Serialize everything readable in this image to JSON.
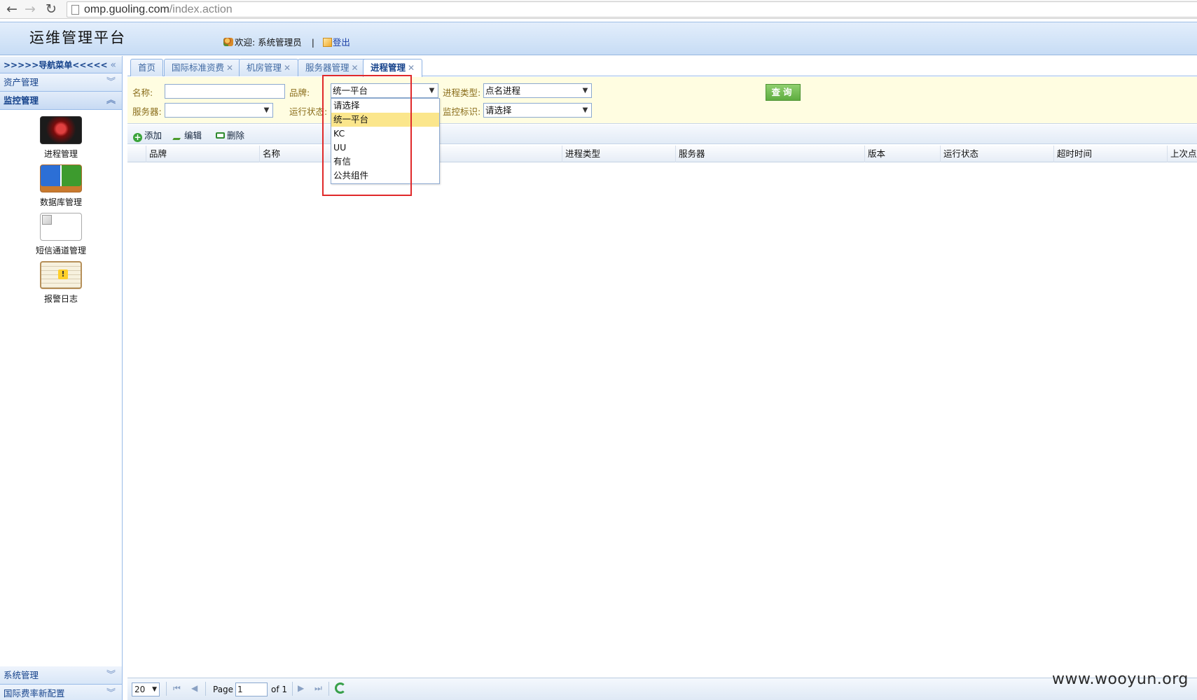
{
  "browser": {
    "url_host": "omp.guoling.com",
    "url_path": "/index.action",
    "back_glyph": "←",
    "forward_glyph": "→",
    "reload_glyph": "↻"
  },
  "header": {
    "title": "运维管理平台",
    "welcome": "欢迎:  系统管理员",
    "separator": "|",
    "logout": "登出"
  },
  "sidebar": {
    "nav_title": ">>>>>导航菜单<<<<<",
    "sections": [
      {
        "label": "资产管理",
        "expanded": false
      },
      {
        "label": "监控管理",
        "expanded": true
      },
      {
        "label": "系统管理",
        "expanded": false
      },
      {
        "label": "国际费率新配置",
        "expanded": false
      }
    ],
    "modules": [
      {
        "label": "进程管理",
        "icon": "process-icon"
      },
      {
        "label": "数据库管理",
        "icon": "database-icon"
      },
      {
        "label": "短信通道管理",
        "icon": "sms-channel-icon"
      },
      {
        "label": "报警日志",
        "icon": "alarm-log-icon"
      }
    ],
    "collapse_glyph": "«",
    "expand_glyph": "»"
  },
  "tabs": [
    {
      "label": "首页",
      "closable": false,
      "active": false
    },
    {
      "label": "国际标准资费",
      "closable": true,
      "active": false
    },
    {
      "label": "机房管理",
      "closable": true,
      "active": false
    },
    {
      "label": "服务器管理",
      "closable": true,
      "active": false
    },
    {
      "label": "进程管理",
      "closable": true,
      "active": true
    }
  ],
  "filter": {
    "name_label": "名称:",
    "name_value": "",
    "brand_label": "品牌:",
    "brand_value": "统一平台",
    "process_type_label": "进程类型:",
    "process_type_value": "点名进程",
    "server_label": "服务器:",
    "server_value": "",
    "run_status_label": "运行状态:",
    "monitor_flag_label": "监控标识:",
    "monitor_flag_value": "请选择",
    "query_button": "查询"
  },
  "brand_dropdown": {
    "options": [
      "请选择",
      "统一平台",
      "KC",
      "UU",
      "有信",
      "公共组件"
    ],
    "selected_index": 1
  },
  "toolbar": {
    "add": "添加",
    "edit": "编辑",
    "delete": "删除"
  },
  "grid": {
    "columns": [
      "品牌",
      "名称",
      "进程类型",
      "服务器",
      "版本",
      "运行状态",
      "超时时间",
      "上次点名"
    ]
  },
  "pager": {
    "page_size": "20",
    "page_label": "Page",
    "current_page": "1",
    "of_label": "of 1"
  },
  "watermark": "www.wooyun.org",
  "colors": {
    "header_bg": "#c7dcf5",
    "filter_bg": "#fffde1",
    "query_button": "#5fad40",
    "highlight_box": "#e0292a",
    "selected_option": "#fbe68c"
  }
}
